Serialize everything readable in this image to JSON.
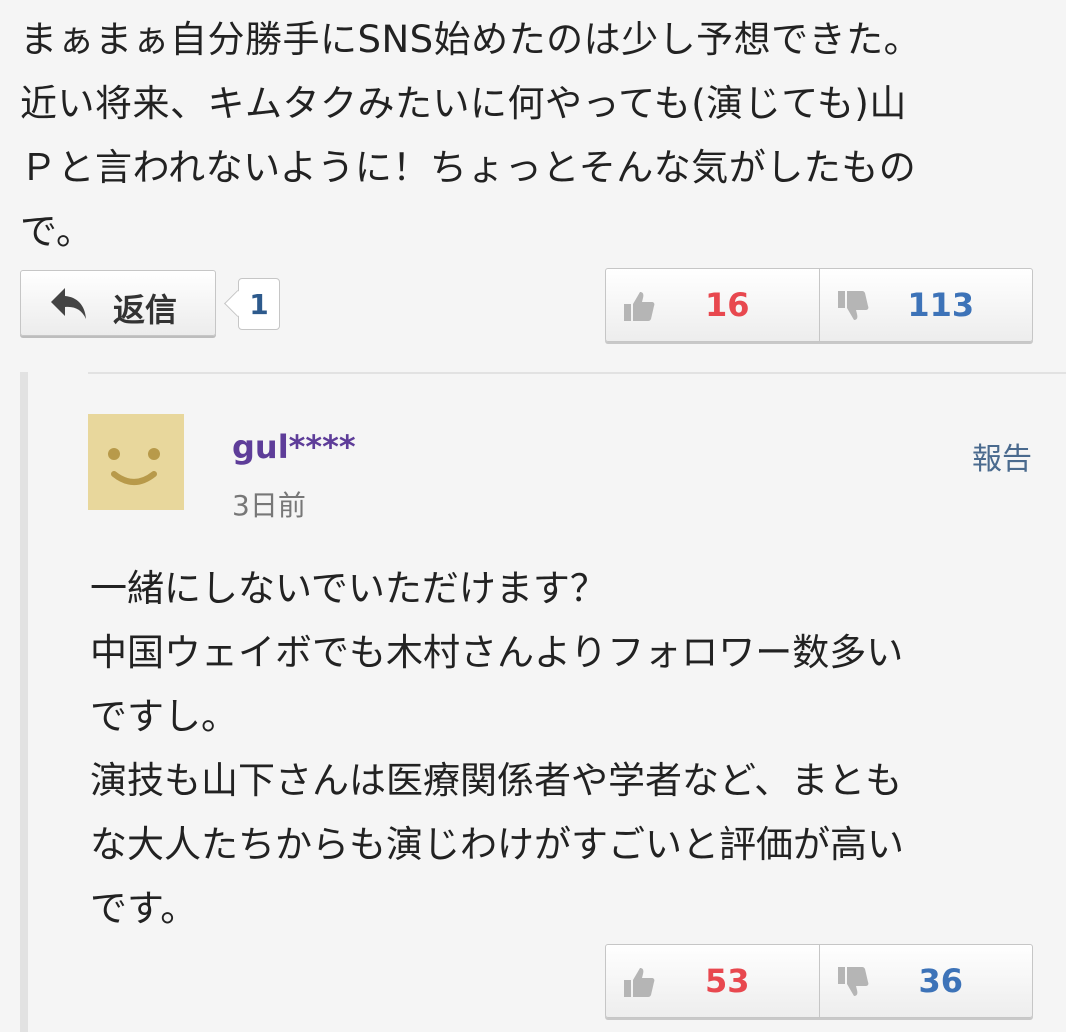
{
  "comment": {
    "lines": [
      "まぁまぁ自分勝手にSNS始めたのは少し予想できた。",
      "近い将来、キムタクみたいに何やっても(演じても)山",
      "Ｐと言われないように！ちょっとそんな気がしたもの",
      "で。"
    ],
    "reply_button_label": "返信",
    "reply_count": "1",
    "votes": {
      "good": "16",
      "bad": "113"
    }
  },
  "reply": {
    "username": "gul****",
    "timestamp": "3日前",
    "report_label": "報告",
    "lines": [
      "一緒にしないでいただけます？",
      "中国ウェイボでも木村さんよりフォロワー数多い",
      "ですし。",
      "演技も山下さんは医療関係者や学者など、まとも",
      "な大人たちからも演じわけがすごいと評価が高い",
      "です。"
    ],
    "votes": {
      "good": "53",
      "bad": "36"
    }
  },
  "colors": {
    "good": "#e8484f",
    "bad": "#3d73b8",
    "username": "#5e3d99",
    "avatar_bg": "#e8d79c"
  },
  "icons": [
    "reply-arrow-icon",
    "thumbs-up-icon",
    "thumbs-down-icon",
    "smiley-avatar-icon"
  ]
}
